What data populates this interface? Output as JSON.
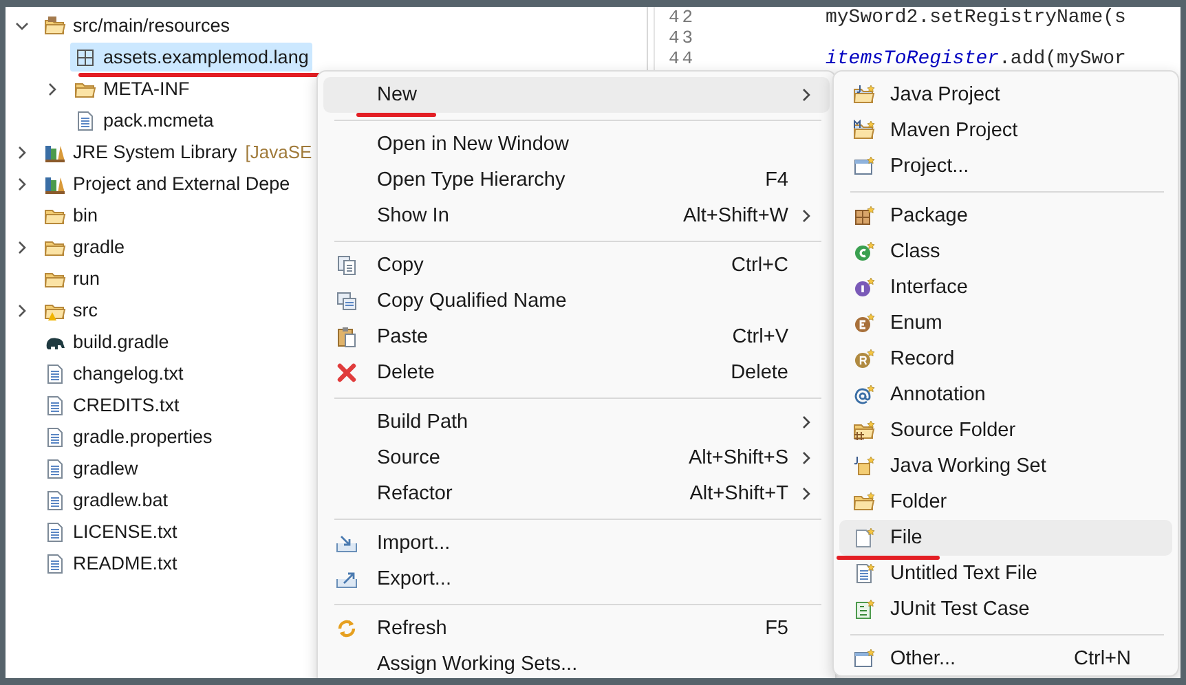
{
  "tree": [
    {
      "label": "src/main/resources",
      "kind": "package-folder",
      "expanded": true,
      "selected": false,
      "underlined": false,
      "children": [
        {
          "label": "assets.examplemod.lang",
          "kind": "package",
          "selected": true,
          "underlined": true
        },
        {
          "label": "META-INF",
          "kind": "folder",
          "expanded": false,
          "selected": false,
          "underlined": false
        },
        {
          "label": "pack.mcmeta",
          "kind": "file",
          "selected": false,
          "underlined": false
        }
      ]
    },
    {
      "label": "JRE System Library",
      "decoration": "[JavaSE",
      "kind": "library",
      "expanded": false,
      "selected": false,
      "underlined": false
    },
    {
      "label": "Project and External Depe",
      "kind": "library",
      "expanded": false,
      "selected": false,
      "underlined": false
    },
    {
      "label": "bin",
      "kind": "folder",
      "selected": false,
      "underlined": false
    },
    {
      "label": "gradle",
      "kind": "folder",
      "expanded": false,
      "selected": false,
      "underlined": false
    },
    {
      "label": "run",
      "kind": "folder",
      "selected": false,
      "underlined": false
    },
    {
      "label": "src",
      "kind": "warn-folder",
      "expanded": false,
      "selected": false,
      "underlined": false
    },
    {
      "label": "build.gradle",
      "kind": "gradle",
      "selected": false,
      "underlined": false
    },
    {
      "label": "changelog.txt",
      "kind": "file",
      "selected": false,
      "underlined": false
    },
    {
      "label": "CREDITS.txt",
      "kind": "file",
      "selected": false,
      "underlined": false
    },
    {
      "label": "gradle.properties",
      "kind": "file",
      "selected": false,
      "underlined": false
    },
    {
      "label": "gradlew",
      "kind": "file",
      "selected": false,
      "underlined": false
    },
    {
      "label": "gradlew.bat",
      "kind": "file",
      "selected": false,
      "underlined": false
    },
    {
      "label": "LICENSE.txt",
      "kind": "file",
      "selected": false,
      "underlined": false
    },
    {
      "label": "README.txt",
      "kind": "file",
      "selected": false,
      "underlined": false
    }
  ],
  "editor": {
    "lines": [
      {
        "number": "42",
        "code": "mySword2.setRegistryName(s"
      },
      {
        "number": "43"
      },
      {
        "number": "44",
        "field": "itemsToRegister",
        "code": ".add(mySwor"
      }
    ]
  },
  "context_menu": [
    {
      "kind": "none",
      "label": "New",
      "submenu": true,
      "hovered": true,
      "underlined": true
    },
    {
      "kind": "separator"
    },
    {
      "kind": "none",
      "label": "Open in New Window",
      "submenu": false,
      "hovered": false,
      "underlined": false
    },
    {
      "kind": "none",
      "label": "Open Type Hierarchy",
      "shortcut": "F4",
      "submenu": false,
      "hovered": false,
      "underlined": false
    },
    {
      "kind": "none",
      "label": "Show In",
      "shortcut": "Alt+Shift+W",
      "submenu": true,
      "hovered": false,
      "underlined": false
    },
    {
      "kind": "separator"
    },
    {
      "kind": "copy",
      "label": "Copy",
      "shortcut": "Ctrl+C",
      "submenu": false,
      "hovered": false,
      "underlined": false
    },
    {
      "kind": "copy-name",
      "label": "Copy Qualified Name",
      "submenu": false,
      "hovered": false,
      "underlined": false
    },
    {
      "kind": "paste",
      "label": "Paste",
      "shortcut": "Ctrl+V",
      "submenu": false,
      "hovered": false,
      "underlined": false
    },
    {
      "kind": "delete",
      "label": "Delete",
      "shortcut": "Delete",
      "submenu": false,
      "hovered": false,
      "underlined": false
    },
    {
      "kind": "separator"
    },
    {
      "kind": "none",
      "label": "Build Path",
      "submenu": true,
      "hovered": false,
      "underlined": false
    },
    {
      "kind": "none",
      "label": "Source",
      "shortcut": "Alt+Shift+S",
      "submenu": true,
      "hovered": false,
      "underlined": false
    },
    {
      "kind": "none",
      "label": "Refactor",
      "shortcut": "Alt+Shift+T",
      "submenu": true,
      "hovered": false,
      "underlined": false
    },
    {
      "kind": "separator"
    },
    {
      "kind": "import",
      "label": "Import...",
      "submenu": false,
      "hovered": false,
      "underlined": false
    },
    {
      "kind": "export",
      "label": "Export...",
      "submenu": false,
      "hovered": false,
      "underlined": false
    },
    {
      "kind": "separator"
    },
    {
      "kind": "refresh",
      "label": "Refresh",
      "shortcut": "F5",
      "submenu": false,
      "hovered": false,
      "underlined": false
    },
    {
      "kind": "none",
      "label": "Assign Working Sets...",
      "submenu": false,
      "hovered": false,
      "underlined": false
    }
  ],
  "new_submenu": [
    {
      "kind": "java-project",
      "label": "Java Project",
      "hovered": false,
      "underlined": false
    },
    {
      "kind": "maven-project",
      "label": "Maven Project",
      "hovered": false,
      "underlined": false
    },
    {
      "kind": "project",
      "label": "Project...",
      "hovered": false,
      "underlined": false
    },
    {
      "kind": "separator"
    },
    {
      "kind": "package",
      "label": "Package",
      "hovered": false,
      "underlined": false
    },
    {
      "kind": "class",
      "label": "Class",
      "hovered": false,
      "underlined": false
    },
    {
      "kind": "interface",
      "label": "Interface",
      "hovered": false,
      "underlined": false
    },
    {
      "kind": "enum",
      "label": "Enum",
      "hovered": false,
      "underlined": false
    },
    {
      "kind": "record",
      "label": "Record",
      "hovered": false,
      "underlined": false
    },
    {
      "kind": "annotation",
      "label": "Annotation",
      "hovered": false,
      "underlined": false
    },
    {
      "kind": "source-folder",
      "label": "Source Folder",
      "hovered": false,
      "underlined": false
    },
    {
      "kind": "working-set",
      "label": "Java Working Set",
      "hovered": false,
      "underlined": false
    },
    {
      "kind": "folder",
      "label": "Folder",
      "hovered": false,
      "underlined": false
    },
    {
      "kind": "file",
      "label": "File",
      "hovered": true,
      "underlined": true
    },
    {
      "kind": "text-file",
      "label": "Untitled Text File",
      "hovered": false,
      "underlined": false
    },
    {
      "kind": "junit",
      "label": "JUnit Test Case",
      "hovered": false,
      "underlined": false
    },
    {
      "kind": "separator"
    },
    {
      "kind": "project",
      "label": "Other...",
      "shortcut": "Ctrl+N",
      "hovered": false,
      "underlined": false
    }
  ]
}
